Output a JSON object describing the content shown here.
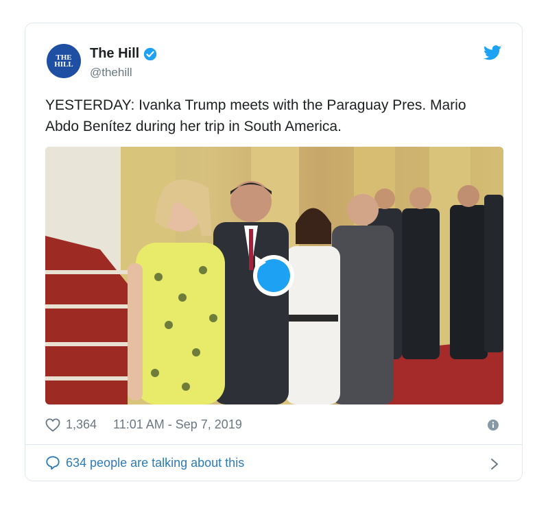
{
  "account": {
    "avatar_line1": "THE",
    "avatar_line2": "HILL",
    "name": "The Hill",
    "handle": "@thehill",
    "verified": true
  },
  "tweet": {
    "text": "YESTERDAY: Ivanka Trump meets with the Paraguay Pres. Mario Abdo Benítez during her trip in South America."
  },
  "media": {
    "type": "video",
    "play_icon": "play-icon"
  },
  "meta": {
    "likes": "1,364",
    "timestamp": "11:01 AM - Sep 7, 2019"
  },
  "footer": {
    "talking": "634 people are talking about this"
  },
  "colors": {
    "accent": "#1da1f2",
    "link": "#2b7bb9",
    "muted": "#697882",
    "border": "#e1e8ed"
  }
}
